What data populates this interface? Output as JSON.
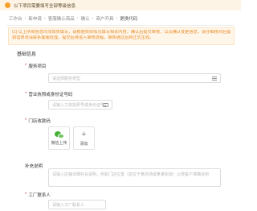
{
  "banner": {
    "text": "以下项目需要填写全部等级信息"
  },
  "breadcrumb": {
    "items": [
      "工作台",
      "新申请",
      "客服确认商品",
      "确认",
      "商户开具",
      "更换代码"
    ]
  },
  "notice": {
    "lines": [
      "(1) 以上所有信息均须如实填写，请根据实际情况填写相关内容，确认后提交审核，以及确认变更信息，请仔细核对后提交。",
      "如需修改请联系客服处理，提交后将进入审核流程，审核通过后将正式生效。"
    ]
  },
  "section": {
    "title": "基础信息"
  },
  "fields": {
    "category": {
      "label": "服务项目",
      "placeholder": "请选择服务类型"
    },
    "id_number": {
      "label": "营业执照或身份证号码",
      "placeholder": "请输入工商执照号或身份证号"
    },
    "qrcode": {
      "label": "门店收款码",
      "upload_label": "微信上传",
      "add_label": "添加"
    },
    "remark": {
      "label": "补充说明",
      "placeholder": "请输入店铺详细补充说明，例如门店位置（如位于某商场或某某街道）以便客户准确找到"
    },
    "contact": {
      "label": "工厂联系人",
      "placeholder": "请输入工厂联系人"
    }
  }
}
